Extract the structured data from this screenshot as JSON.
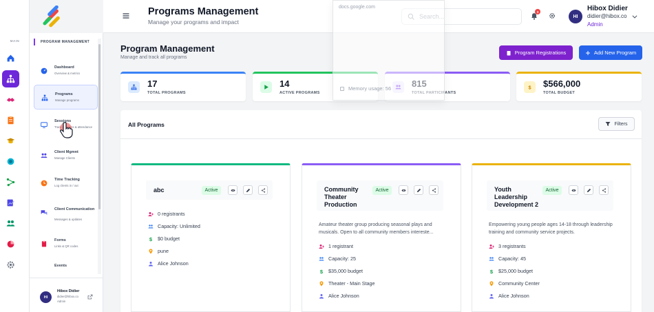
{
  "rail": {
    "label": "MAIN"
  },
  "header": {
    "title": "Programs Management",
    "subtitle": "Manage your programs and impact",
    "search_placeholder": "Search...",
    "notification_count": "3",
    "user": {
      "name": "Hibox Didier",
      "email": "didier@hibox.co",
      "role": "Admin",
      "initials": "HI"
    }
  },
  "popup": {
    "url": "docs.google.com",
    "memory": "Memory usage: 56"
  },
  "sidebar": {
    "heading": "PROGRAM MANAGEMENT",
    "items": [
      {
        "title": "Dashboard",
        "sub": "Overview & metrics"
      },
      {
        "title": "Programs",
        "sub": "Manage programs"
      },
      {
        "title": "Sessions",
        "sub": "Track sessions & attendance"
      },
      {
        "title": "Client Mgmnt",
        "sub": "Manage Clients"
      },
      {
        "title": "Time Tracking",
        "sub": "Log clients in / out"
      },
      {
        "title": "Client Communication",
        "sub": "Messages & updates"
      },
      {
        "title": "Forms",
        "sub": "Links & QR codes"
      },
      {
        "title": "Events",
        "sub": ""
      }
    ],
    "user": {
      "name": "Hibox Didier",
      "email": "didier@hibox.co",
      "role": "Admin",
      "initials": "HI"
    }
  },
  "main": {
    "title": "Program Management",
    "subtitle": "Manage and track all programs",
    "btn_registrations": "Program Registrations",
    "btn_add": "Add New Program",
    "stats": [
      {
        "value": "17",
        "label": "TOTAL PROGRAMS"
      },
      {
        "value": "14",
        "label": "ACTIVE PROGRAMS"
      },
      {
        "value": "815",
        "label": "TOTAL PARTICIPANTS"
      },
      {
        "value": "$566,000",
        "label": "TOTAL BUDGET"
      }
    ],
    "panel_title": "All Programs",
    "filters_label": "Filters"
  },
  "programs": [
    {
      "name": "abc",
      "status": "Active",
      "registrants": "0 registrants",
      "capacity": "Capacity: Unlimited",
      "budget": "$0 budget",
      "location": "pune",
      "manager": "Alice Johnson"
    },
    {
      "name": "Community Theater Production",
      "status": "Active",
      "description": "Amateur theater group producing seasonal plays and musicals. Open to all community members intereste...",
      "registrants": "1 registrant",
      "capacity": "Capacity: 25",
      "budget": "$35,000 budget",
      "location": "Theater - Main Stage",
      "manager": "Alice Johnson"
    },
    {
      "name": "Youth Leadership Development 2",
      "status": "Active",
      "description": "Empowering young people ages 14-18 through leadership training and community service projects.",
      "registrants": "3 registrants",
      "capacity": "Capacity: 45",
      "budget": "$25,000 budget",
      "location": "Community Center",
      "manager": "Alice Johnson"
    }
  ],
  "colors": {
    "accent_purple": "#7e22ce",
    "accent_blue": "#2563eb",
    "stat_blue": "#3b82f6",
    "stat_green": "#22c55e",
    "stat_purple": "#8b5cf6",
    "stat_amber": "#eab308"
  }
}
